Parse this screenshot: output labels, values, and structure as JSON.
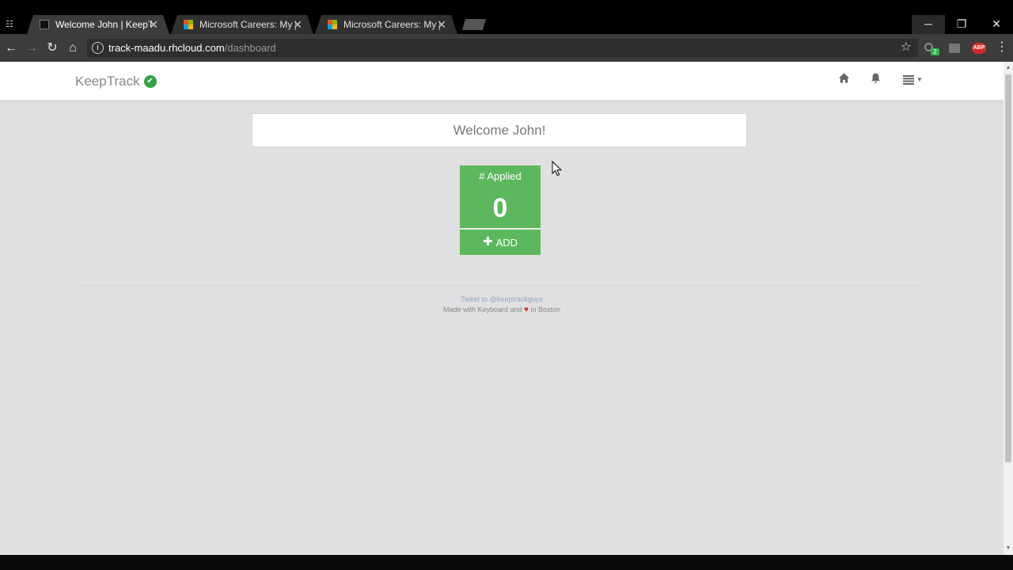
{
  "browser": {
    "tabs": [
      {
        "title": "Welcome John | KeepTrack",
        "active": true,
        "favicon": "keeptrack-favicon"
      },
      {
        "title": "Microsoft Careers: My jobs",
        "active": false,
        "favicon": "microsoft-logo-icon"
      },
      {
        "title": "Microsoft Careers: My jobs",
        "active": false,
        "favicon": "microsoft-logo-icon"
      }
    ],
    "url_host": "track-maadu.rhcloud.com",
    "url_path": "/dashboard",
    "extension_badge": "2",
    "abp_label": "ABP"
  },
  "app": {
    "brand": "KeepTrack",
    "brand_color": "#35a242",
    "nav_icons": [
      "home-icon",
      "bell-icon",
      "list-menu-icon"
    ]
  },
  "dashboard": {
    "welcome": "Welcome John!",
    "tile": {
      "label": "# Applied",
      "count": "0",
      "add_label": "ADD",
      "color": "#5cb85c"
    }
  },
  "footer": {
    "tweet": "Tweet to @keeptrackguys",
    "made_with_prefix": "Made with Keyboard and",
    "made_with_suffix": "in Boston"
  }
}
